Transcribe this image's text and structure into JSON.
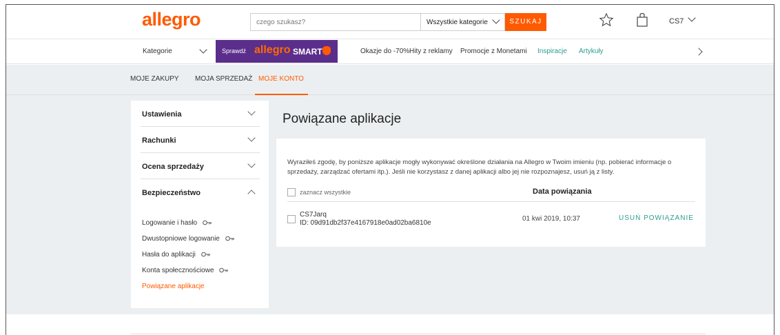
{
  "header": {
    "logo": "allegro",
    "search_placeholder": "czego szukasz?",
    "category_select": "Wszystkie kategorie",
    "search_button": "SZUKAJ",
    "user": "CS7"
  },
  "nav": {
    "categories": "Kategorie",
    "smart_prefix": "Sprawdź",
    "smart_brand": "allegro",
    "smart_word": "SMART",
    "links": [
      "Okazje do -70%",
      "Hity z reklamy",
      "Promocje z Monetami",
      "Inspiracje",
      "Artykuły"
    ]
  },
  "subnav": {
    "items": [
      "MOJE ZAKUPY",
      "MOJA SPRZEDAŻ",
      "MOJE KONTO"
    ]
  },
  "sidebar": {
    "sections": [
      "Ustawienia",
      "Rachunki",
      "Ocena sprzedaży",
      "Bezpieczeństwo"
    ],
    "security_items": [
      "Logowanie i hasło",
      "Dwustopniowe logowanie",
      "Hasła do aplikacji",
      "Konta społecznościowe",
      "Powiązane aplikacje"
    ]
  },
  "main": {
    "title": "Powiązane aplikacje",
    "description": "Wyraziłeś zgodę, by poniższe aplikacje mogły wykonywać określone działania na Allegro w Twoim imieniu (np. pobierać informacje o sprzedaży, zarządzać ofertami itp.). Jeśli nie korzystasz z danej aplikacji albo jej nie rozpoznajesz, usuń ją z listy.",
    "select_all": "zaznacz wszystkie",
    "date_header": "Data powiązania",
    "apps": [
      {
        "name": "CS7Jarq",
        "id": "ID: 09d91db2f37e4167918e0ad02ba6810e",
        "date": "01 kwi 2019, 10:37",
        "action": "USUŃ POWIĄZANIE"
      }
    ]
  },
  "colors": {
    "brand": "#ff5a00",
    "smart_banner": "#5b2e8c",
    "link_teal": "#2a9d8f",
    "page_bg": "#eceff1"
  }
}
